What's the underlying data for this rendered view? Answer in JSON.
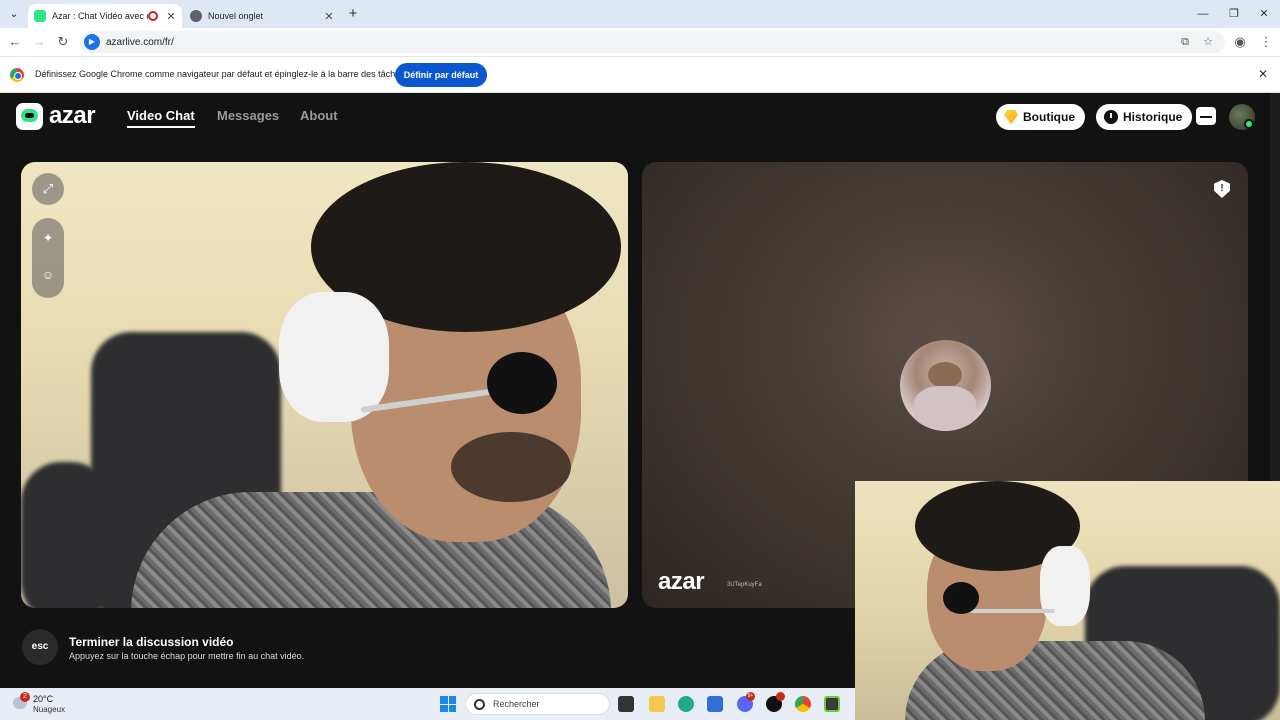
{
  "browser": {
    "tabs": [
      {
        "title": "Azar : Chat Vidéo avec de n",
        "active": true
      },
      {
        "title": "Nouvel onglet",
        "active": false
      }
    ],
    "url": "azarlive.com/fr/",
    "infobar": {
      "message": "Définissez Google Chrome comme navigateur par défaut et épinglez-le à la barre des tâches",
      "button": "Définir par défaut"
    }
  },
  "app": {
    "logo": "azar",
    "nav": [
      "Video Chat",
      "Messages",
      "About"
    ],
    "active_nav": "Video Chat",
    "shop_label": "Boutique",
    "history_label": "Historique",
    "watermark_logo": "azar",
    "watermark_id": "3UTepKuyFa",
    "esc": {
      "key": "esc",
      "title": "Terminer la discussion vidéo",
      "subtitle": "Appuyez sur la touche échap pour mettre fin au chat vidéo."
    }
  },
  "taskbar": {
    "temperature": "20°C",
    "condition": "Nuageux",
    "weather_badge": "2",
    "search_placeholder": "Rechercher",
    "discord_badge": "9+"
  },
  "colors": {
    "accent": "#2ee58a",
    "chrome_button": "#0b57d0",
    "app_bg": "#121212"
  }
}
